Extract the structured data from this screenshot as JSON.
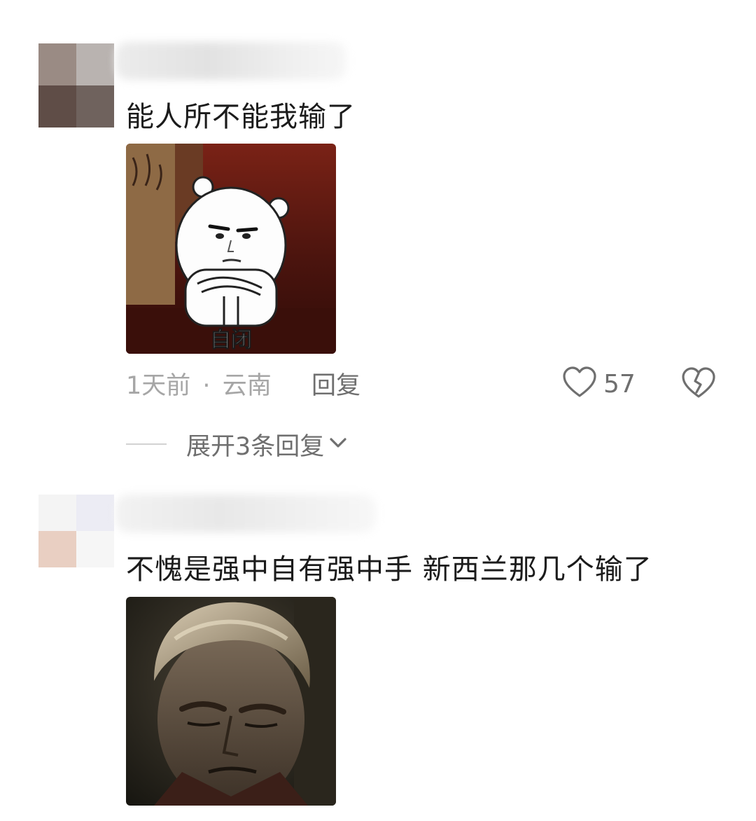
{
  "comments": [
    {
      "text": "能人所不能我输了",
      "sticker": {
        "caption": "自闭"
      },
      "time": "1天前",
      "separator": "·",
      "location": "云南",
      "reply_label": "回复",
      "likes": "57",
      "expand_label": "展开3条回复"
    },
    {
      "text": "不愧是强中自有强中手 新西兰那几个输了"
    }
  ],
  "icons": {
    "like": "heart-outline-icon",
    "dislike": "broken-heart-icon",
    "expand": "chevron-down-icon"
  },
  "colors": {
    "text_primary": "#1b1b1b",
    "text_meta": "#a6a6a6",
    "text_action": "#6f6f6f"
  }
}
